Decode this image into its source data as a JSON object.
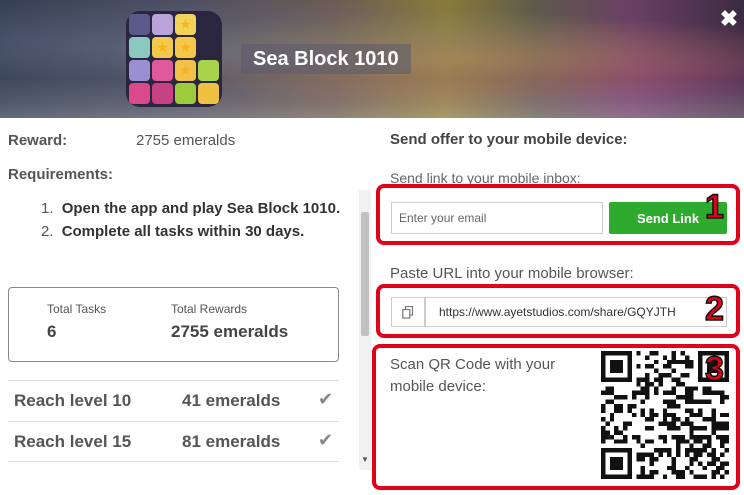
{
  "header": {
    "app_title": "Sea Block 1010",
    "close_symbol": "✖"
  },
  "offer": {
    "reward_label": "Reward:",
    "reward_value": "2755 emeralds",
    "requirements_label": "Requirements:",
    "requirements": [
      {
        "num": "1.",
        "text": "Open the app and play Sea Block 1010."
      },
      {
        "num": "2.",
        "text": "Complete all tasks within 30 days."
      }
    ],
    "summary": {
      "total_tasks_label": "Total Tasks",
      "total_tasks_value": "6",
      "total_rewards_label": "Total Rewards",
      "total_rewards_value": "2755 emeralds"
    },
    "tasks": [
      {
        "name": "Reach level 10",
        "reward": "41 emeralds",
        "check": "✔"
      },
      {
        "name": "Reach level 15",
        "reward": "81 emeralds",
        "check": "✔"
      }
    ]
  },
  "send": {
    "title": "Send offer to your mobile device:",
    "email_hint": "Send link to your mobile inbox:",
    "email_placeholder": "Enter your email",
    "send_button": "Send Link",
    "url_hint": "Paste URL into your mobile browser:",
    "url_value": "https://www.ayetstudios.com/share/GQYJTH",
    "qr_hint": "Scan QR Code with your mobile device:"
  },
  "annotations": {
    "badge1": "1",
    "badge2": "2",
    "badge3": "3",
    "color": "#e0001a"
  },
  "colors": {
    "accent_green": "#2eaa2e"
  },
  "icons": {
    "close": "close-icon",
    "copy": "copy-icon",
    "check": "check-icon",
    "qr": "qr-code"
  }
}
